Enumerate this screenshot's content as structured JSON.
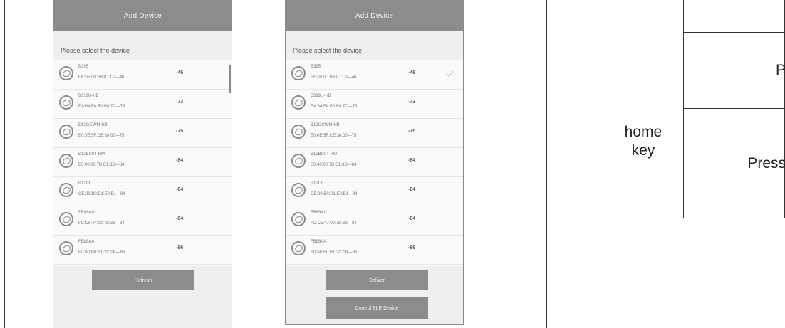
{
  "screens": [
    {
      "title": "Add Device",
      "prompt": "Please select the device",
      "devices": [
        {
          "name": "B395",
          "mac": "EF:05:0D:B6:0T:1D—46",
          "rssi": "-46"
        },
        {
          "name": "B319U-HB",
          "mac": "EA:64:FA:B0:B8:7C—73",
          "rssi": "-73"
        },
        {
          "name": "B12GCWM-HB",
          "mac": "E0:0E:5F:CE:38:00—75",
          "rssi": "-75"
        },
        {
          "name": "B12BC04-HM",
          "mac": "E0:40:00:7D:E1:3D—84",
          "rssi": "-84"
        },
        {
          "name": "B12CL",
          "mac": "CE:29:B0:D1:E0:B1—84",
          "rssi": "-84"
        },
        {
          "name": "FB88AU",
          "mac": "FC:C5:47:00:7B:3B—84",
          "rssi": "-84"
        },
        {
          "name": "FB88AA",
          "mac": "E0:A0:B0:B1:2C:0B—86",
          "rssi": "-86"
        }
      ],
      "buttons": [
        "Refresh"
      ]
    },
    {
      "title": "Add Device",
      "prompt": "Please select the device",
      "devices": [
        {
          "name": "B395",
          "mac": "EF:05:0D:B6:0T:1D—46",
          "rssi": "-46"
        },
        {
          "name": "B319U-HB",
          "mac": "EA:64:FA:B0:B8:7C—73",
          "rssi": "-73"
        },
        {
          "name": "B12GCWM-HB",
          "mac": "E0:0E:5F:CE:38:00—75",
          "rssi": "-75"
        },
        {
          "name": "B12BC04-HM",
          "mac": "E0:40:00:7D:E1:3D—84",
          "rssi": "-84"
        },
        {
          "name": "B12CL",
          "mac": "CE:29:B0:D1:E0:B1—84",
          "rssi": "-84"
        },
        {
          "name": "FB88AU",
          "mac": "FC:C5:47:00:7B:3B—84",
          "rssi": "-84"
        },
        {
          "name": "FB88AA",
          "mac": "E0:A0:B0:B1:2C:0B—86",
          "rssi": "-86"
        }
      ],
      "buttons": [
        "Deliver",
        "Control BLE Device"
      ]
    }
  ],
  "diagram": {
    "key_label": "home key",
    "rows": [
      "P",
      "Press"
    ]
  },
  "colors": {
    "header": "#8c8c8c",
    "screen_bg": "#efefef",
    "list_bg": "#fafafa"
  },
  "icons": [
    "bluetooth-device-icon",
    "checkmark-icon"
  ]
}
